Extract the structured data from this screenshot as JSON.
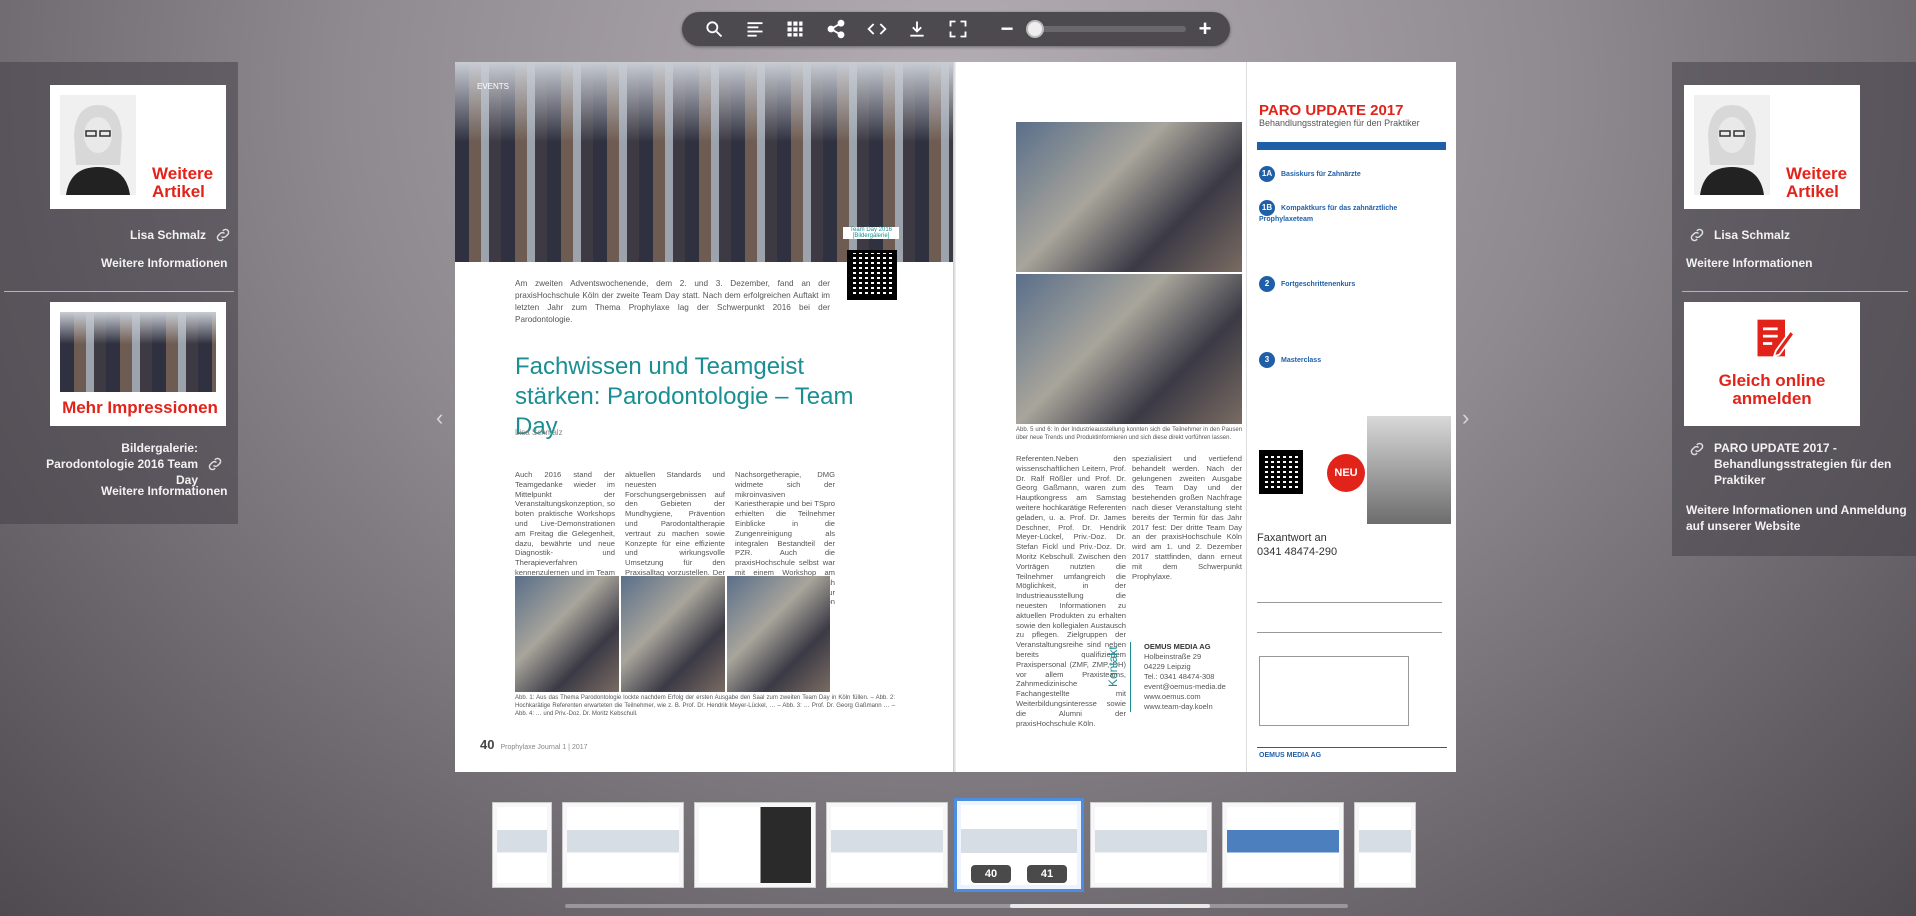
{
  "toolbar": {
    "icons": [
      "search-icon",
      "table-of-contents-icon",
      "grid-view-icon",
      "share-icon",
      "embed-code-icon",
      "download-icon",
      "fullscreen-icon"
    ],
    "zoom_minus": "−",
    "zoom_plus": "+",
    "zoom_level_fraction": 0.0
  },
  "left_panel": {
    "card1_cta": "Weitere Artikel",
    "author_link": "Lisa Schmalz",
    "more_info_1": "Weitere Informationen",
    "card2_cta": "Mehr Impressionen",
    "gallery_link": "Bildergalerie: Parodontologie 2016 Team Day",
    "more_info_2": "Weitere Informationen"
  },
  "right_panel": {
    "card1_cta": "Weitere Artikel",
    "author_link": "Lisa Schmalz",
    "more_info_1": "Weitere Informationen",
    "card2_cta": "Gleich online anmelden",
    "event_link": "PARO UPDATE 2017 - Behandlungsstrategien für den Praktiker",
    "more_info_2": "Weitere Informationen und Anmeldung auf unserer Website"
  },
  "magazine": {
    "left_page": {
      "section_label": "EVENTS",
      "qr_caption": "Team Day 2016",
      "qr_caption_sub": "[Bildergalerie]",
      "intro": "Am zweiten Adventswochenende, dem 2. und 3. Dezember, fand an der praxisHochschule Köln der zweite Team Day statt. Nach dem erfolgreichen Auftakt im letzten Jahr zum Thema Prophylaxe lag der Schwerpunkt 2016 bei der Parodontologie.",
      "title": "Fachwissen und Teamgeist stärken: Parodontologie – Team Day",
      "author": "Lisa Schmalz",
      "body1": "Auch 2016 stand der Teamgedanke wieder im Mittelpunkt der Veranstaltungskonzeption, so boten praktische Workshops und Live-Demonstrationen am Freitag die Gelegenheit, dazu, bewährte und neue Diagnostik- und Therapieverfahren kennenzulernen und im Team anzuwenden. Anspruch war es außerdem, Praxisteams mit den",
      "body2": "aktuellen Standards und neuesten Forschungsergebnissen auf den Gebieten der Mundhygiene, Prävention und Parodontaltherapie vertraut zu machen sowie Konzepte für eine effiziente und wirkungsvolle Umsetzung für den Praxisalltag vorzustellen. Der Workshop der Firma Sunstar beschäftigte sich mit der UPT als individuelle und risikoorientierte",
      "body3": "Nachsorgetherapie, DMG widmete sich der mikroinvasiven Kariestherapie und bei TSpro erhielten die Teilnehmer Einblicke in die Zungenreinigung als integralen Bestandteil der PZR. Auch die praxisHochschule selbst war mit einem Workshop am Freitag vertreten, hier sprach Prof. Dr. Georg Gaßmann zur mobilen Betreuung von Senioren.",
      "caption": "Abb. 1: Aus das Thema Parodontologie lockte nachdem Erfolg der ersten Ausgabe den Saal zum zweiten Team Day in Köln füllen. – Abb. 2: Hochkarätige Referenten erwarteten die Teilnehmer, wie z. B. Prof. Dr. Hendrik Meyer-Lückel, … – Abb. 3: … Prof. Dr. Georg Gaßmann … – Abb. 4: … und Priv.-Doz. Dr. Moritz Kebschull.",
      "page_number": "40",
      "footer": "Prophylaxe Journal 1 | 2017"
    },
    "right_page": {
      "caption": "Abb. 5 und 6: In der Industrieausstellung konnten sich die Teilnehmer in den Pausen über neue Trends und Produktinformieren und sich diese direkt vorführen lassen.",
      "body1": "Referenten.Neben den wissenschaftlichen Leitern, Prof. Dr. Ralf Rößler und Prof. Dr. Georg Gaßmann, waren zum Hauptkongress am Samstag weitere hochkarätige Referenten geladen, u. a. Prof. Dr. James Deschner, Prof. Dr. Hendrik Meyer-Lückel, Priv.-Doz. Dr. Stefan Fickl und Priv.-Doz. Dr. Moritz Kebschull. Zwischen den Vorträgen nutzten die Teilnehmer umfangreich die Möglichkeit, in der Industrieausstellung die neuesten Informationen zu aktuellen Produkten zu erhalten sowie den kollegialen Austausch zu pflegen. Zielgruppen der Veranstaltungsreihe sind neben bereits qualifiziertem Praxispersonal (ZMF, ZMP, DH) vor allem Praxisteams, Zahnmedizinische Fachangestellte mit Weiterbildungsinteresse sowie die Alumni der praxisHochschule Köln.",
      "body2": "spezialisiert und vertiefend behandelt werden. Nach der gelungenen zweiten Ausgabe des Team Day und der bestehenden großen Nachfrage nach dieser Veranstaltung steht bereits der Termin für das Jahr 2017 fest: Der dritte Team Day an der praxisHochschule Köln wird am 1. und 2. Dezember 2017 stattfinden, dann erneut mit dem Schwerpunkt Prophylaxe.",
      "kontakt_label": "Kontakt",
      "kontakt_company": "OEMUS MEDIA AG",
      "kontakt_lines": "Holbeinstraße 29\n04229 Leipzig\nTel.: 0341 48474-308\nevent@oemus-media.de\nwww.oemus.com\nwww.team-day.koeln",
      "ad_title": "PARO UPDATE 2017",
      "ad_sub": "Behandlungsstrategien für den Praktiker",
      "ad_items": [
        "Basiskurs für Zahnärzte",
        "Kompaktkurs für das zahnärztliche Prophylaxeteam",
        "Fortgeschrittenenkurs",
        "Masterclass"
      ],
      "ad_item_numbers": [
        "1A",
        "1B",
        "2",
        "3"
      ],
      "neu_badge": "NEU",
      "fax_head": "Faxantwort an",
      "fax_number": "0341 48474-290",
      "ad_footer": "OEMUS MEDIA AG"
    }
  },
  "navigation": {
    "prev_arrow": "‹",
    "next_arrow": "›"
  },
  "thumbnails": {
    "active_left_page": "40",
    "active_right_page": "41"
  }
}
